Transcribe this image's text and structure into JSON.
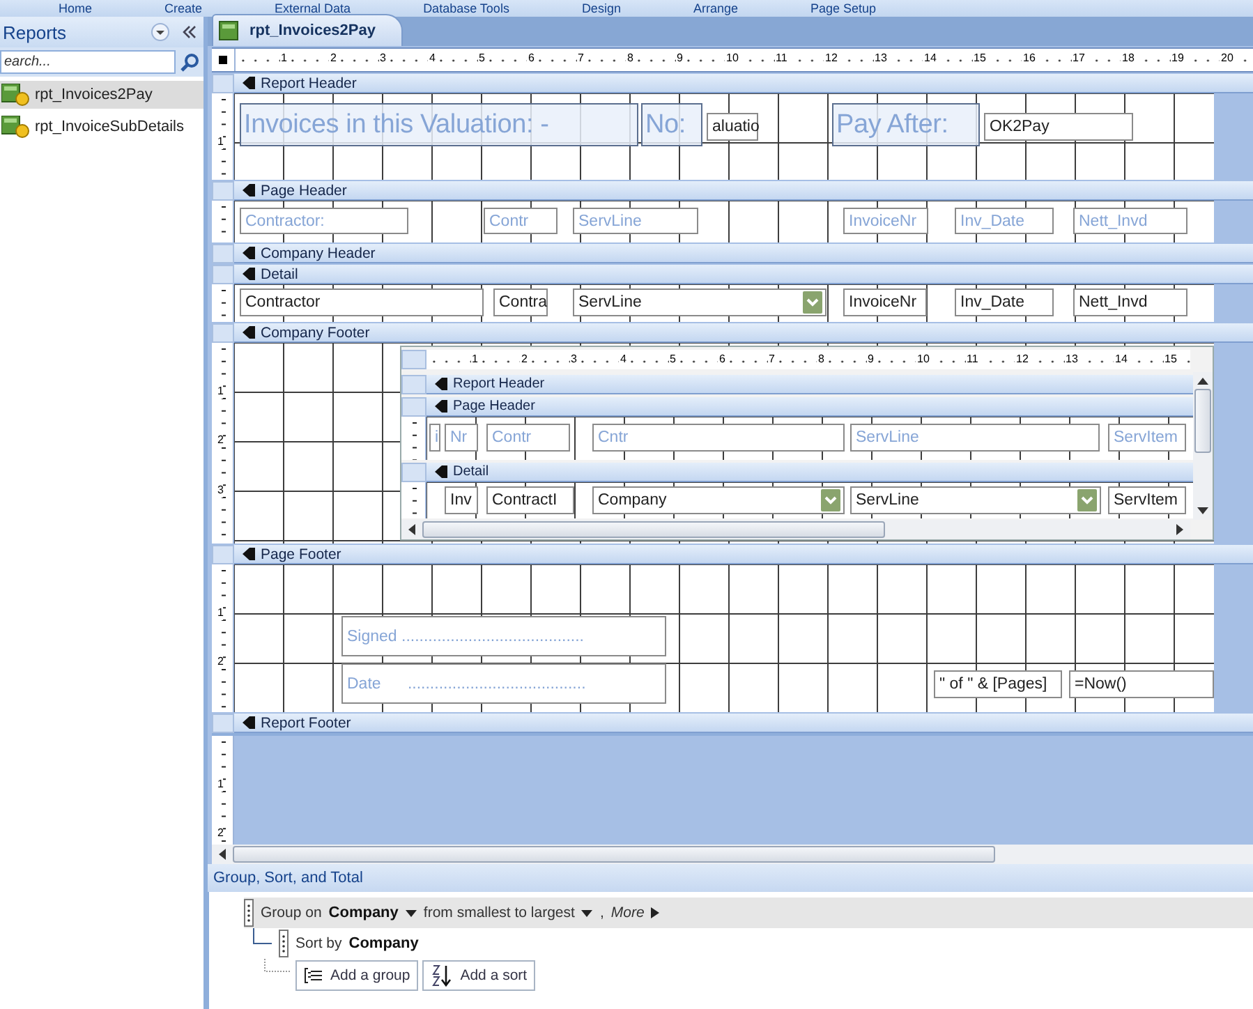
{
  "ribbon_tabs": [
    "Home",
    "Create",
    "External Data",
    "Database Tools",
    "Design",
    "Arrange",
    "Page Setup"
  ],
  "nav_pane": {
    "title": "Reports",
    "search": {
      "placeholder": "earch..."
    },
    "items": [
      {
        "label": "rpt_Invoices2Pay",
        "selected": true
      },
      {
        "label": "rpt_InvoiceSubDetails",
        "selected": false
      }
    ]
  },
  "document_tab": {
    "title": "rpt_Invoices2Pay"
  },
  "ruler": [
    "1",
    "2",
    "3",
    "4",
    "5",
    "6",
    "7",
    "8",
    "9",
    "10",
    "11",
    "12",
    "13",
    "14",
    "15",
    "16",
    "17",
    "18",
    "19",
    "20"
  ],
  "sections": [
    {
      "title": "Report Header",
      "ruler_marks": [
        "1"
      ],
      "controls": [
        {
          "kind": "title",
          "text": "Invoices in this Valuation: -"
        },
        {
          "kind": "title",
          "text": "No:"
        },
        {
          "kind": "textbox",
          "text": "aluatio"
        },
        {
          "kind": "title",
          "text": "Pay After:"
        },
        {
          "kind": "textbox",
          "text": "OK2Pay"
        }
      ]
    },
    {
      "title": "Page Header",
      "controls": [
        {
          "kind": "label",
          "text": "Contractor:"
        },
        {
          "kind": "label",
          "text": "Contr"
        },
        {
          "kind": "label",
          "text": "ServLine"
        },
        {
          "kind": "label",
          "text": "InvoiceNr"
        },
        {
          "kind": "label",
          "text": "Inv_Date"
        },
        {
          "kind": "label",
          "text": "Nett_Invd"
        }
      ]
    },
    {
      "title": "Company Header"
    },
    {
      "title": "Detail",
      "controls": [
        {
          "kind": "textbox",
          "text": "Contractor"
        },
        {
          "kind": "textbox",
          "text": "Contra"
        },
        {
          "kind": "combo",
          "text": "ServLine"
        },
        {
          "kind": "textbox",
          "text": "InvoiceNr"
        },
        {
          "kind": "textbox",
          "text": "Inv_Date"
        },
        {
          "kind": "textbox",
          "text": "Nett_Invd"
        }
      ]
    },
    {
      "title": "Company Footer",
      "ruler_marks": [
        "1",
        "2",
        "3"
      ],
      "controls": [
        {
          "kind": "subreport",
          "ruler": [
            "1",
            "2",
            "3",
            "4",
            "5",
            "6",
            "7",
            "8",
            "9",
            "10",
            "11",
            "12",
            "13",
            "14",
            "15"
          ],
          "sections": [
            {
              "title": "Report Header"
            },
            {
              "title": "Page Header",
              "controls": [
                {
                  "kind": "label",
                  "text": "i"
                },
                {
                  "kind": "label",
                  "text": "Nr"
                },
                {
                  "kind": "label",
                  "text": "Contr"
                },
                {
                  "kind": "label",
                  "text": "Cntr"
                },
                {
                  "kind": "label",
                  "text": "ServLine"
                },
                {
                  "kind": "label",
                  "text": "ServItem"
                }
              ]
            },
            {
              "title": "Detail",
              "controls": [
                {
                  "kind": "textbox",
                  "text": "Inv"
                },
                {
                  "kind": "textbox",
                  "text": "ContractI"
                },
                {
                  "kind": "combo",
                  "text": "Company"
                },
                {
                  "kind": "combo",
                  "text": "ServLine"
                },
                {
                  "kind": "textbox",
                  "text": "ServItem"
                }
              ]
            }
          ]
        }
      ]
    },
    {
      "title": "Page Footer",
      "ruler_marks": [
        "1",
        "2"
      ],
      "controls": [
        {
          "kind": "label",
          "text": "Signed ........................................."
        },
        {
          "kind": "label",
          "text": "Date      ........................................"
        },
        {
          "kind": "textbox",
          "text": "\" of \" & [Pages]"
        },
        {
          "kind": "textbox",
          "text": "=Now()"
        }
      ]
    },
    {
      "title": "Report Footer"
    }
  ],
  "trailing_ruler_marks": [
    "1",
    "2"
  ],
  "group_sort": {
    "title": "Group, Sort, and Total",
    "levels": [
      {
        "kind": "group",
        "prefix": "Group on",
        "field": "Company",
        "order": "from smallest to largest",
        "separator": ",",
        "more": "More"
      },
      {
        "kind": "sort",
        "prefix": "Sort by",
        "field": "Company"
      }
    ],
    "buttons": [
      "Add a group",
      "Add a sort"
    ]
  }
}
